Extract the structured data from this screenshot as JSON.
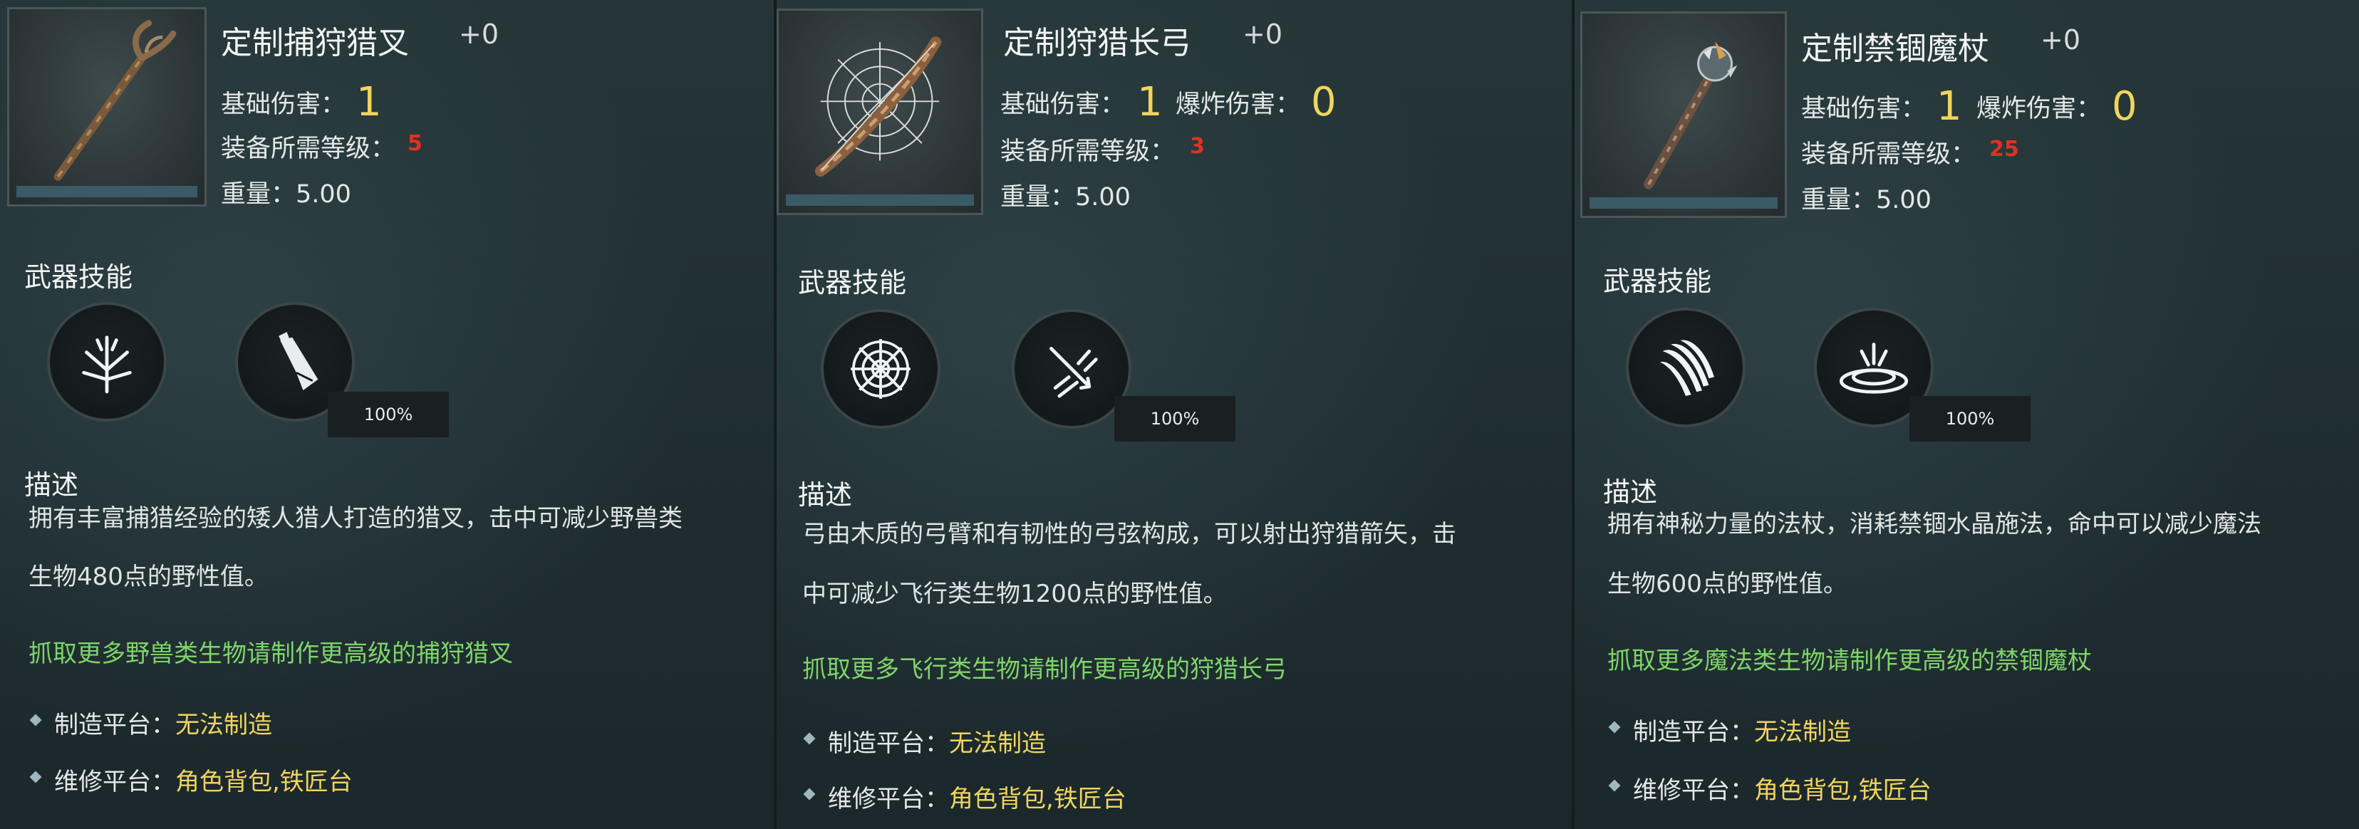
{
  "section_labels": {
    "skills": "武器技能",
    "description": "描述"
  },
  "stat_labels": {
    "base_damage": "基础伤害：",
    "explosion_damage": "爆炸伤害：",
    "required_level": "装备所需等级：",
    "weight": "重量："
  },
  "platform_labels": {
    "craft": "制造平台：",
    "repair": "维修平台："
  },
  "cards": [
    {
      "name": "定制捕狩猎叉",
      "enhance": "+0",
      "base_damage": "1",
      "required_level": "5",
      "weight": "5.00",
      "skill_cooldown": "100%",
      "skill_icons": [
        "frost-burst-icon",
        "spear-thrust-icon"
      ],
      "item_icon": "hunting-fork-icon",
      "desc_line1": "拥有丰富捕猎经验的矮人猎人打造的猎叉，击中可减少野兽类",
      "desc_line2": "生物480点的野性值。",
      "hint": "抓取更多野兽类生物请制作更高级的捕狩猎叉",
      "craft": "无法制造",
      "repair": "角色背包,铁匠台"
    },
    {
      "name": "定制狩猎长弓",
      "enhance": "+0",
      "base_damage": "1",
      "explosion_damage": "0",
      "required_level": "3",
      "weight": "5.00",
      "skill_cooldown": "100%",
      "skill_icons": [
        "spider-web-icon",
        "arrow-volley-icon"
      ],
      "item_icon": "hunting-bow-icon",
      "desc_line1": "弓由木质的弓臂和有韧性的弓弦构成，可以射出狩猎箭矢，击",
      "desc_line2": "中可减少飞行类生物1200点的野性值。",
      "hint": "抓取更多飞行类生物请制作更高级的狩猎长弓",
      "craft": "无法制造",
      "repair": "角色背包,铁匠台"
    },
    {
      "name": "定制禁锢魔杖",
      "enhance": "+0",
      "base_damage": "1",
      "explosion_damage": "0",
      "required_level": "25",
      "weight": "5.00",
      "skill_cooldown": "100%",
      "skill_icons": [
        "claw-slash-icon",
        "binding-circle-icon"
      ],
      "item_icon": "magic-staff-icon",
      "desc_line1": "拥有神秘力量的法杖，消耗禁锢水晶施法，命中可以减少魔法",
      "desc_line2": "生物600点的野性值。",
      "hint": "抓取更多魔法类生物请制作更高级的禁锢魔杖",
      "craft": "无法制造",
      "repair": "角色背包,铁匠台"
    }
  ]
}
